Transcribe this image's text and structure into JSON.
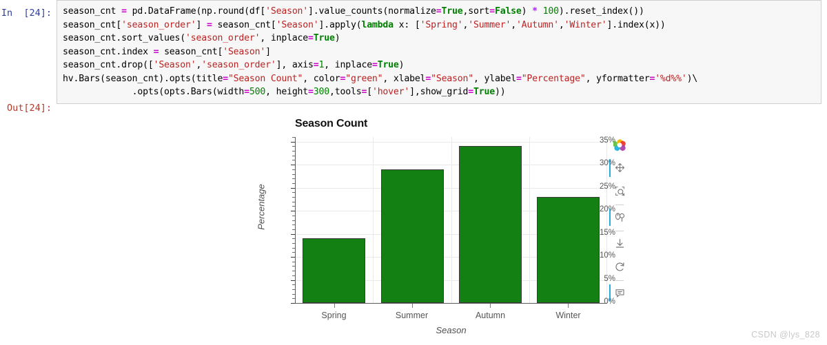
{
  "notebook": {
    "in_prompt": "In  [24]:",
    "out_prompt": "Out[24]:",
    "code_lines": [
      "season_cnt = pd.DataFrame(np.round(df['Season'].value_counts(normalize=True,sort=False) * 100).reset_index())",
      "season_cnt['season_order'] = season_cnt['Season'].apply(lambda x: ['Spring','Summer','Autumn','Winter'].index(x))",
      "season_cnt.sort_values('season_order', inplace=True)",
      "season_cnt.index = season_cnt['Season']",
      "season_cnt.drop(['Season','season_order'], axis=1, inplace=True)",
      "hv.Bars(season_cnt).opts(title=\"Season Count\", color=\"green\", xlabel=\"Season\", ylabel=\"Percentage\", yformatter='%d%%')\\",
      "             .opts(opts.Bars(width=500, height=300,tools=['hover'],show_grid=True))"
    ]
  },
  "chart_data": {
    "type": "bar",
    "title": "Season Count",
    "xlabel": "Season",
    "ylabel": "Percentage",
    "categories": [
      "Spring",
      "Summer",
      "Autumn",
      "Winter"
    ],
    "values": [
      14,
      29,
      34,
      23
    ],
    "ylim": [
      0,
      36
    ],
    "ytick_labels": [
      "0%",
      "5%",
      "10%",
      "15%",
      "20%",
      "25%",
      "30%",
      "35%"
    ],
    "ytick_values": [
      0,
      5,
      10,
      15,
      20,
      25,
      30,
      35
    ],
    "yformatter": "%d%%",
    "grid": true,
    "legend": "none",
    "bar_color": "#128012",
    "bar_line_color": "#3a3a3a"
  },
  "toolbar": {
    "items": [
      {
        "name": "bokeh-logo-icon",
        "label": "Bokeh",
        "active": false,
        "interactable": true
      },
      {
        "name": "pan-tool-icon",
        "label": "Pan",
        "active": true,
        "interactable": true
      },
      {
        "name": "box-zoom-tool-icon",
        "label": "Box Zoom",
        "active": false,
        "interactable": true
      },
      {
        "name": "wheel-zoom-tool-icon",
        "label": "Wheel Zoom",
        "active": true,
        "interactable": true
      },
      {
        "name": "save-tool-icon",
        "label": "Save",
        "active": false,
        "interactable": true
      },
      {
        "name": "reset-tool-icon",
        "label": "Reset",
        "active": false,
        "interactable": true
      },
      {
        "name": "hover-tool-icon",
        "label": "Hover",
        "active": true,
        "interactable": true
      }
    ]
  },
  "watermark": {
    "text": "CSDN @lys_828"
  },
  "colors": {
    "bar_green": "#128012",
    "accent_blue": "#26aae1",
    "in_prompt": "#303F9F",
    "out_prompt": "#b5392a",
    "string_token": "#bb2222",
    "keyword_token": "#008000",
    "operator_token": "#aa22ff"
  }
}
